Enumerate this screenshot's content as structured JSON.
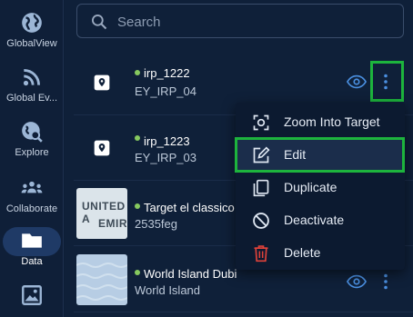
{
  "sidebar": {
    "items": [
      {
        "label": "GlobalView",
        "icon": "globe-icon"
      },
      {
        "label": "Global Ev...",
        "icon": "rss-icon"
      },
      {
        "label": "Explore",
        "icon": "globe-search-icon"
      },
      {
        "label": "Collaborate",
        "icon": "team-icon"
      },
      {
        "label": "Data",
        "icon": "folder-icon",
        "active": true
      },
      {
        "label": "",
        "icon": "image-icon"
      }
    ]
  },
  "search": {
    "placeholder": "Search"
  },
  "list": {
    "items": [
      {
        "name": "irp_1222",
        "sub": "EY_IRP_04",
        "thumbnail": "pin-icon",
        "status_color": "#86c95f"
      },
      {
        "name": "irp_1223",
        "sub": "EY_IRP_03",
        "thumbnail": "pin-icon",
        "status_color": "#86c95f"
      },
      {
        "name": "Target el classico",
        "sub": "2535feg",
        "thumbnail_text": [
          "UNITED A",
          "EMIRA"
        ],
        "status_color": "#86c95f"
      },
      {
        "name": "World Island Dubai",
        "name_visible": "World Island Dubi",
        "sub": "World Island",
        "thumbnail": "map-thumbnail",
        "status_color": "#86c95f"
      }
    ]
  },
  "context_menu": {
    "items": [
      {
        "label": "Zoom Into Target",
        "icon": "zoom-target-icon"
      },
      {
        "label": "Edit",
        "icon": "edit-icon",
        "selected": true
      },
      {
        "label": "Duplicate",
        "icon": "duplicate-icon"
      },
      {
        "label": "Deactivate",
        "icon": "deactivate-icon"
      },
      {
        "label": "Delete",
        "icon": "trash-icon",
        "color": "#e0423a"
      }
    ]
  },
  "colors": {
    "accent": "#4a8fe0",
    "status": "#86c95f",
    "highlight": "#1db43d",
    "danger": "#e0423a"
  }
}
